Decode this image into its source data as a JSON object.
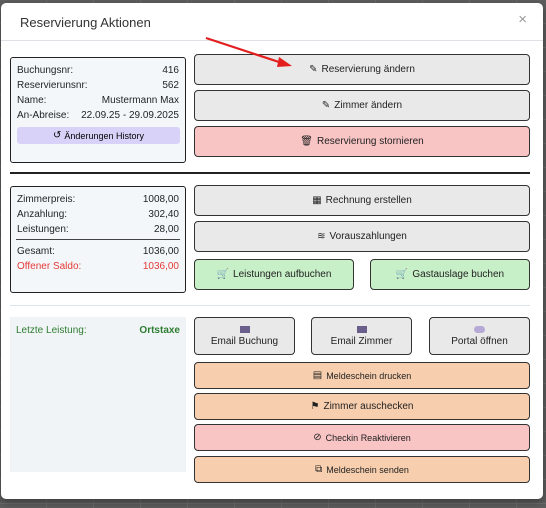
{
  "modal": {
    "title": "Reservierung Aktionen",
    "close": "×"
  },
  "booking": {
    "rows": [
      {
        "label": "Buchungsnr:",
        "value": "416"
      },
      {
        "label": "Reservierunsnr:",
        "value": "562"
      },
      {
        "label": "Name:",
        "value": "Mustermann Max"
      },
      {
        "label": "An-Abreise:",
        "value": "22.09.25 - 29.09.2025"
      }
    ],
    "history_label": "Änderungen History"
  },
  "prices": {
    "rows": [
      {
        "label": "Zimmerpreis:",
        "value": "1008,00"
      },
      {
        "label": "Anzahlung:",
        "value": "302,40"
      },
      {
        "label": "Leistungen:",
        "value": "28,00"
      }
    ],
    "total": {
      "label": "Gesamt:",
      "value": "1036,00"
    },
    "open_balance": {
      "label": "Offener Saldo:",
      "value": "1036,00"
    }
  },
  "last_service": {
    "label": "Letzte Leistung:",
    "value": "Ortstaxe"
  },
  "buttons": {
    "edit_reservation": "Reservierung ändern",
    "edit_room": "Zimmer ändern",
    "cancel_reservation": "Reservierung stornieren",
    "create_invoice": "Rechnung erstellen",
    "prepayments": "Vorauszahlungen",
    "book_services": "Leistungen aufbuchen",
    "book_guest_expense": "Gastauslage buchen",
    "email_booking": "Email Buchung",
    "email_room": "Email Zimmer",
    "open_portal": "Portal öffnen",
    "print_registration": "Meldeschein drucken",
    "checkout_room": "Zimmer auschecken",
    "reactivate_checkin": "Checkin Reaktivieren",
    "send_registration": "Meldeschein senden"
  },
  "colors": {
    "accent_red": "#e53935",
    "green_text": "#2e7d32",
    "history_bg": "#d8d2f8",
    "cancel_bg": "#f8c4c4",
    "book_bg": "#c8f0c8",
    "action_bg": "#f8cfae"
  }
}
